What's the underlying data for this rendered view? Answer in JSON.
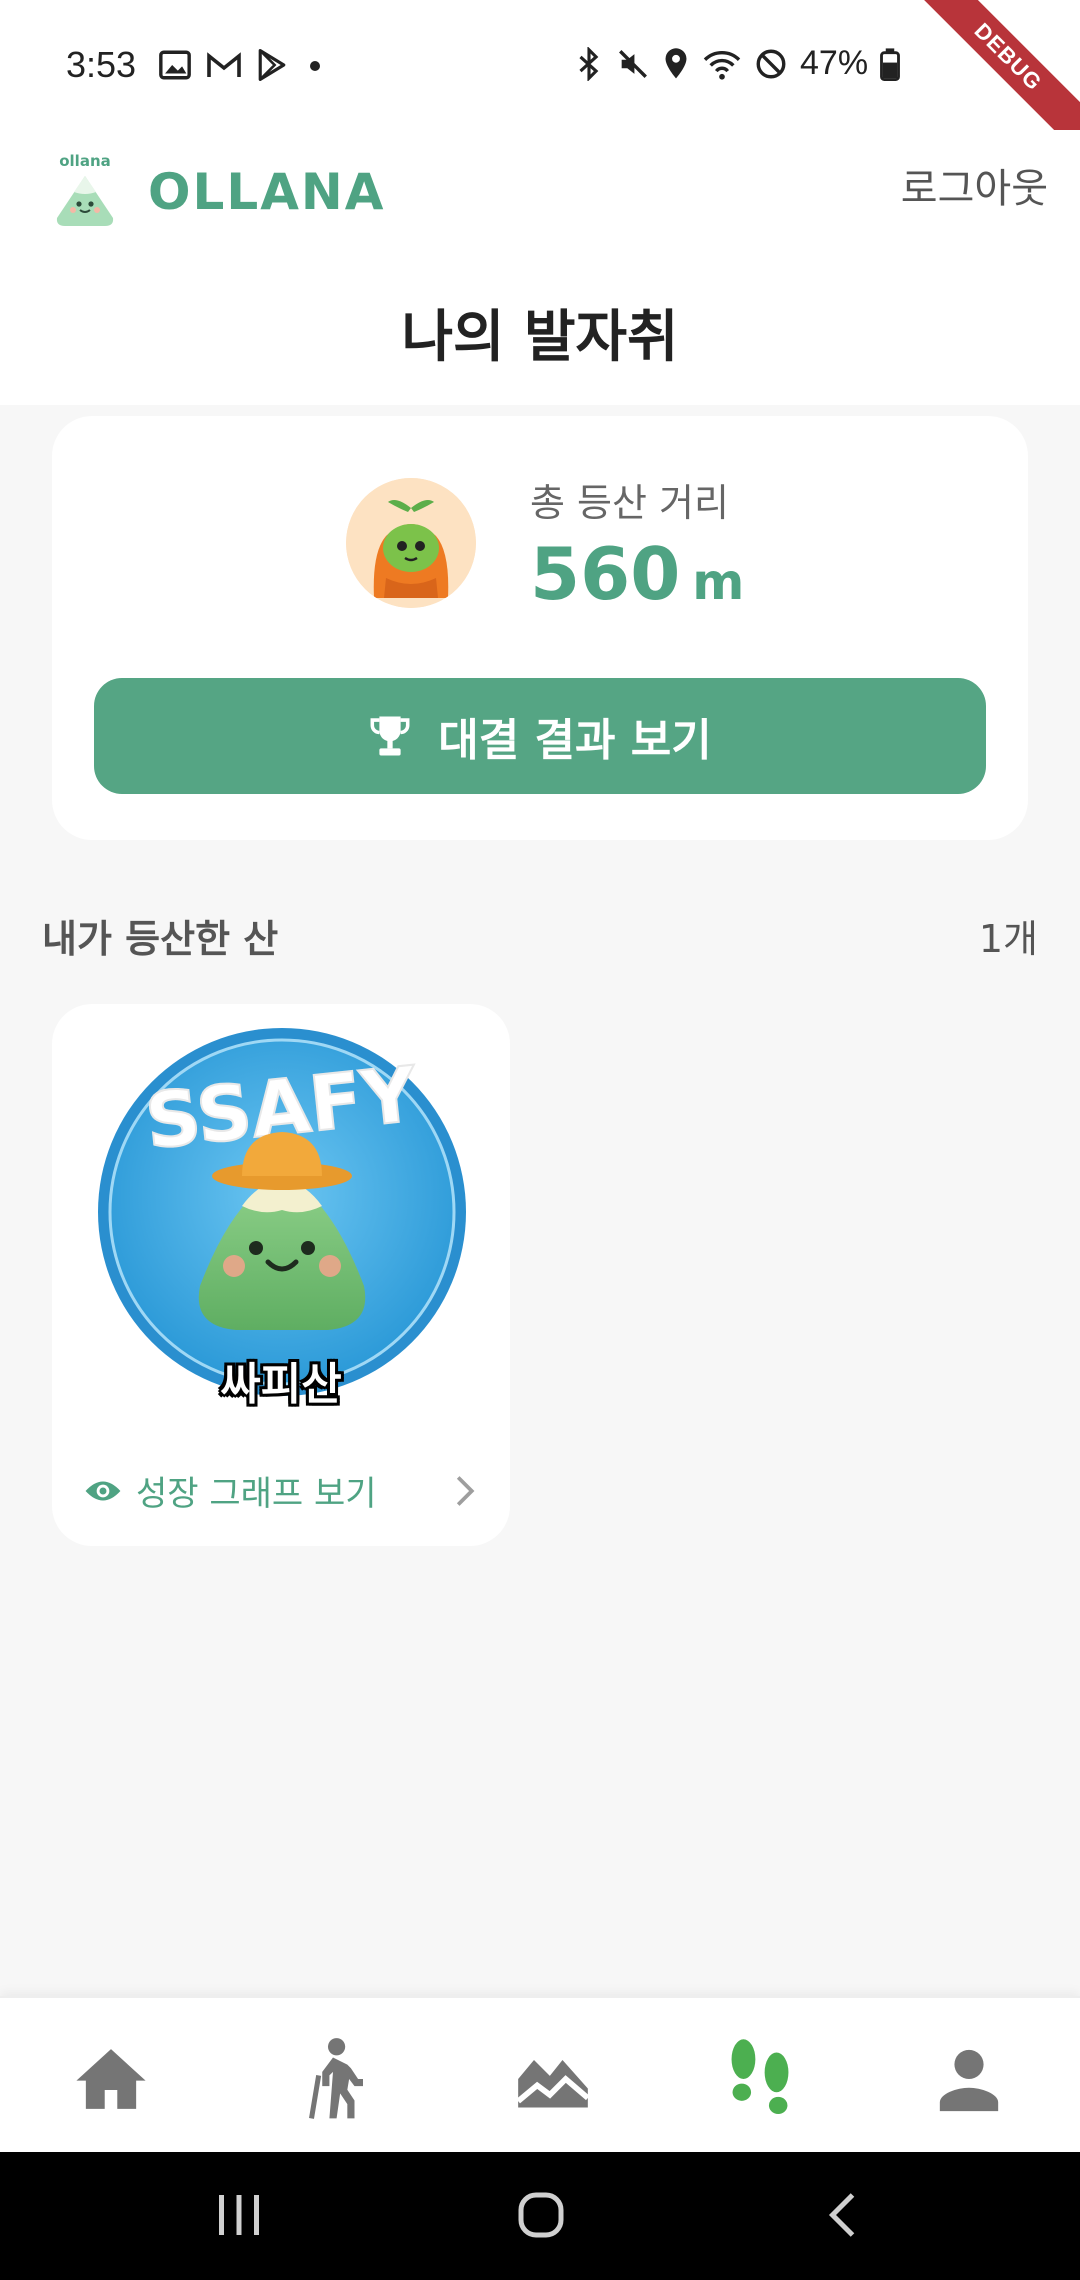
{
  "status_bar": {
    "time": "3:53",
    "battery": "47%",
    "left_icons": [
      "image-icon",
      "gmail-icon",
      "play-store-icon",
      "dot-icon"
    ],
    "right_icons": [
      "bluetooth-icon",
      "mute-icon",
      "location-icon",
      "wifi-icon",
      "dnd-icon",
      "battery-icon"
    ],
    "debug_label": "DEBUG"
  },
  "header": {
    "logo_small_text": "ollana",
    "logo_text": "OLLANA",
    "logout_label": "로그아웃",
    "page_title": "나의 발자취"
  },
  "summary": {
    "total_label": "총 등산 거리",
    "total_value": "560",
    "total_unit": "m",
    "battle_button_label": "대결 결과 보기"
  },
  "climbed": {
    "section_title": "내가 등산한 산",
    "count": "1개",
    "mountains": [
      {
        "badge_text": "SSAFY",
        "name": "싸피산",
        "growth_link_label": "성장 그래프 보기"
      }
    ]
  },
  "bottom_nav": {
    "items": [
      "home-icon",
      "hiking-icon",
      "mountain-icon",
      "footprints-icon",
      "person-icon"
    ],
    "active_index": 3
  },
  "colors": {
    "accent": "#55a584",
    "accent_text": "#4fa383",
    "inactive_icon": "#757575",
    "active_icon": "#4caf50",
    "debug": "#b8343a"
  }
}
